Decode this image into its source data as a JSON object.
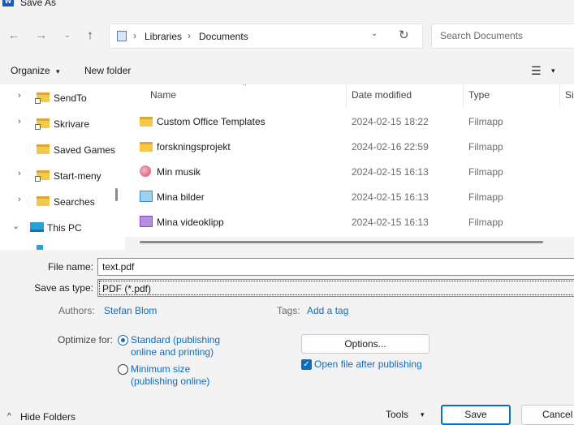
{
  "window": {
    "title": "Save As",
    "app_icon": "W"
  },
  "nav": {
    "back_icon": "←",
    "forward_icon": "→",
    "recent_icon": "⌄",
    "up_icon": "↑",
    "breadcrumb": [
      "Libraries",
      "Documents"
    ],
    "separator": "›",
    "dropdown_icon": "⌄",
    "refresh_icon": "↻",
    "search_placeholder": "Search Documents"
  },
  "toolbar": {
    "organize": "Organize",
    "organize_dd": "▾",
    "new_folder": "New folder",
    "view_icon": "☰",
    "view_dd": "▾"
  },
  "sidebar": {
    "chevron": "›",
    "items": [
      {
        "label": "SendTo"
      },
      {
        "label": "Skrivare"
      },
      {
        "label": "Saved Games"
      },
      {
        "label": "Start-meny"
      },
      {
        "label": "Searches"
      },
      {
        "label": "This PC"
      }
    ],
    "expanded_chevron": "⌄"
  },
  "columns": {
    "name": "Name",
    "date": "Date modified",
    "type": "Type",
    "size": "Size",
    "sort_icon": "^"
  },
  "files": [
    {
      "name": "Custom Office Templates",
      "date": "2024-02-15 18:22",
      "type": "Filmapp",
      "icon": "folder-icon"
    },
    {
      "name": "forskningsprojekt",
      "date": "2024-02-16 22:59",
      "type": "Filmapp",
      "icon": "folder-icon"
    },
    {
      "name": "Min musik",
      "date": "2024-02-15 16:13",
      "type": "Filmapp",
      "icon": "music-folder-icon"
    },
    {
      "name": "Mina bilder",
      "date": "2024-02-15 16:13",
      "type": "Filmapp",
      "icon": "pictures-folder-icon"
    },
    {
      "name": "Mina videoklipp",
      "date": "2024-02-15 16:13",
      "type": "Filmapp",
      "icon": "videos-folder-icon"
    }
  ],
  "form": {
    "file_name_label": "File name:",
    "file_name_value": "text.pdf",
    "save_type_label": "Save as type:",
    "save_type_value": "PDF (*.pdf)",
    "authors_label": "Authors:",
    "authors_value": "Stefan Blom",
    "tags_label": "Tags:",
    "tags_value": "Add a tag",
    "optimize_label": "Optimize for:",
    "opt_standard_1": "Standard (publishing",
    "opt_standard_2": "online and printing)",
    "opt_minimum_1": "Minimum size",
    "opt_minimum_2": "(publishing online)",
    "options_button": "Options...",
    "open_after_label": "Open file after publishing",
    "check_mark": "✓"
  },
  "footer": {
    "hide_folders_icon": "^",
    "hide_folders": "Hide Folders",
    "tools": "Tools",
    "tools_dd": "▾",
    "save": "Save",
    "cancel": "Cancel"
  },
  "colors": {
    "accent": "#0f6cbd",
    "folder": "#f2c94c",
    "background": "#f3f3f3"
  }
}
